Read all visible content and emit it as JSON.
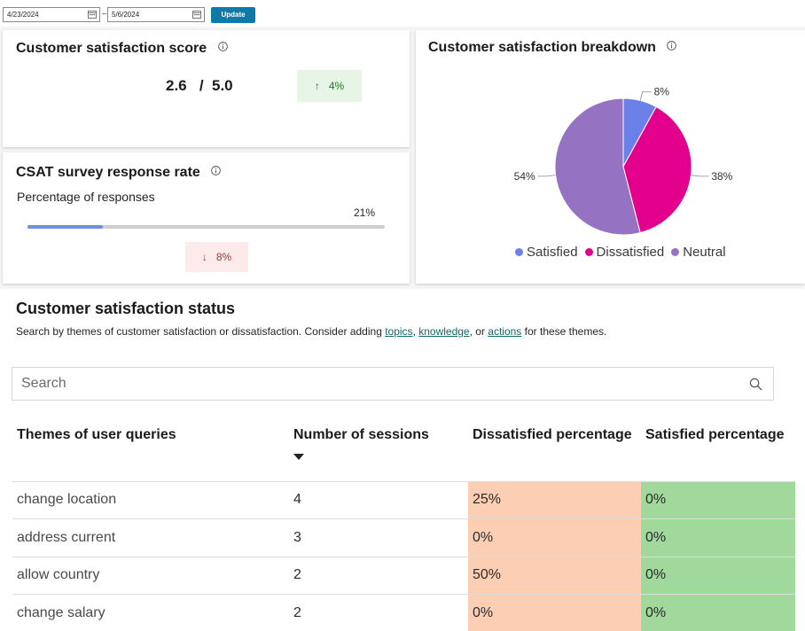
{
  "date_range": {
    "start": "4/23/2024",
    "separator": "–",
    "end": "5/6/2024",
    "update_label": "Update"
  },
  "csat_score": {
    "title": "Customer satisfaction score",
    "score": "2.6",
    "separator": "/",
    "max": "5.0",
    "trend_arrow": "↑",
    "trend_value": "4%"
  },
  "response_rate": {
    "title": "CSAT survey response rate",
    "subtitle": "Percentage of responses",
    "value_label": "21%",
    "progress": 0.21,
    "trend_arrow": "↓",
    "trend_value": "8%"
  },
  "breakdown": {
    "title": "Customer satisfaction breakdown",
    "chart_data": {
      "type": "pie",
      "slices": [
        {
          "name": "Satisfied",
          "value": 8,
          "label": "8%",
          "color": "#6b80e8"
        },
        {
          "name": "Dissatisfied",
          "value": 38,
          "label": "38%",
          "color": "#e3008c"
        },
        {
          "name": "Neutral",
          "value": 54,
          "label": "54%",
          "color": "#9673c2"
        }
      ],
      "legend_position": "bottom"
    }
  },
  "status": {
    "title": "Customer satisfaction status",
    "description_prefix": "Search by themes of customer satisfaction or dissatisfaction. Consider adding ",
    "link_topics": "topics",
    "comma": ", ",
    "link_knowledge": "knowledge",
    "or_text": ", or ",
    "link_actions": "actions",
    "description_suffix": " for these themes.",
    "search_placeholder": "Search",
    "columns": [
      "Themes of user queries",
      "Number of sessions",
      "Dissatisfied percentage",
      "Satisfied percentage"
    ],
    "rows": [
      {
        "theme": "change location",
        "sessions": "4",
        "dissatisfied": "25%",
        "satisfied": "0%"
      },
      {
        "theme": "address current",
        "sessions": "3",
        "dissatisfied": "0%",
        "satisfied": "0%"
      },
      {
        "theme": "allow country",
        "sessions": "2",
        "dissatisfied": "50%",
        "satisfied": "0%"
      },
      {
        "theme": "change salary",
        "sessions": "2",
        "dissatisfied": "0%",
        "satisfied": "0%"
      }
    ]
  }
}
